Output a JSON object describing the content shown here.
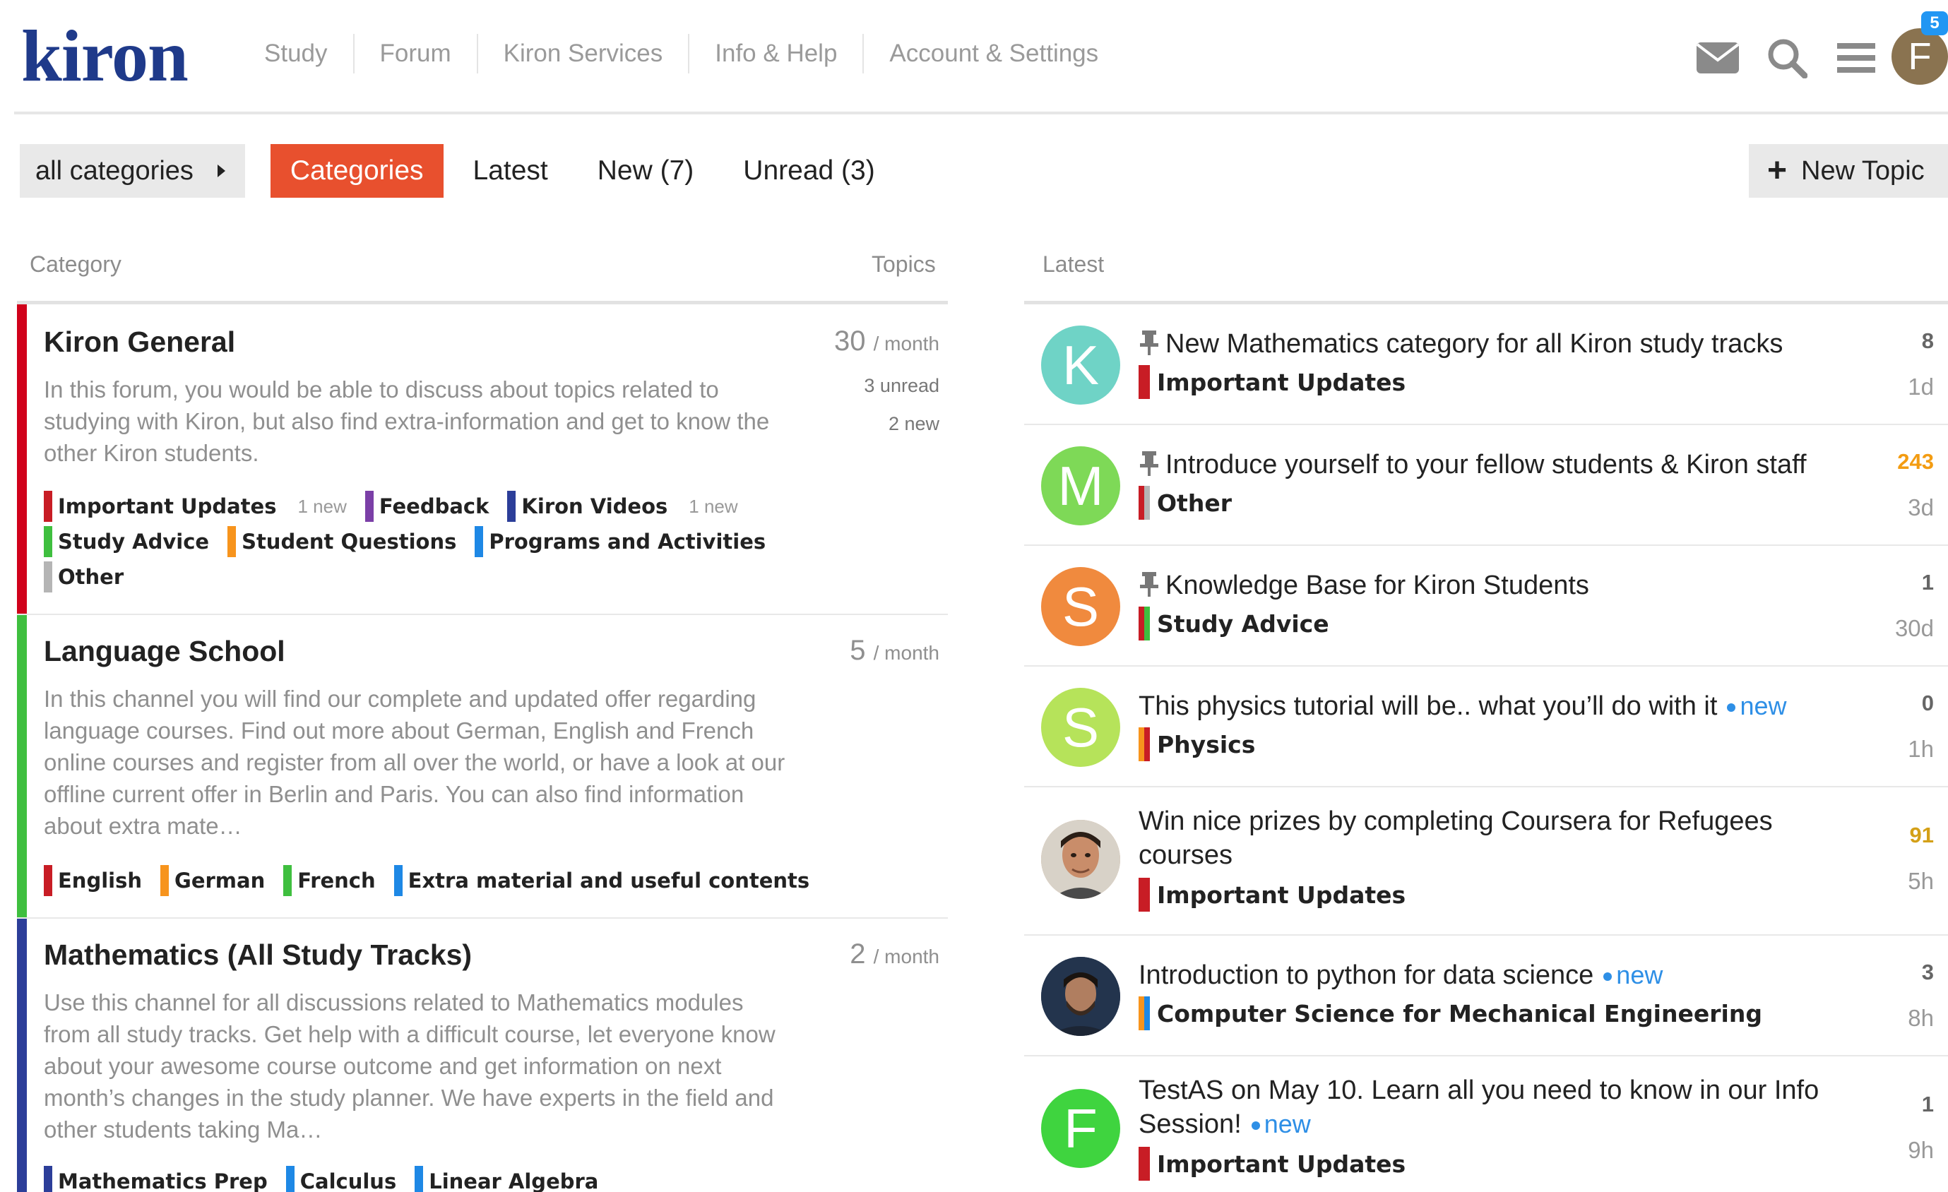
{
  "app": {
    "logo": "kiron",
    "nav": [
      "Study",
      "Forum",
      "Kiron Services",
      "Info & Help",
      "Account & Settings"
    ],
    "avatar_letter": "F",
    "notifications": "5"
  },
  "filters": {
    "dropdown": "all categories",
    "tabs": [
      {
        "label": "Categories",
        "active": true
      },
      {
        "label": "Latest",
        "active": false
      },
      {
        "label": "New (7)",
        "active": false
      },
      {
        "label": "Unread (3)",
        "active": false
      }
    ],
    "new_topic": "New Topic"
  },
  "columns": {
    "category": "Category",
    "topics": "Topics",
    "latest": "Latest"
  },
  "categories": [
    {
      "name": "Kiron General",
      "color": "#d0021b",
      "description": "In this forum, you would be able to discuss about topics related to studying with Kiron, but also find extra-information and get to know the other Kiron students.",
      "count": "30",
      "per": "/ month",
      "unread": "3 unread",
      "new": "2 new",
      "subcategories": [
        [
          {
            "name": "Important Updates",
            "color": "#c81d25",
            "new": "1 new"
          },
          {
            "name": "Feedback",
            "color": "#7b3fa7"
          },
          {
            "name": "Kiron Videos",
            "color": "#2c3e99",
            "new": "1 new"
          }
        ],
        [
          {
            "name": "Study Advice",
            "color": "#3fbf3f"
          },
          {
            "name": "Student Questions",
            "color": "#f7941d"
          },
          {
            "name": "Programs and Activities",
            "color": "#1e88e5"
          }
        ],
        [
          {
            "name": "Other",
            "color": "#b5b5b5"
          }
        ]
      ]
    },
    {
      "name": "Language School",
      "color": "#3fbf3f",
      "description": "In this channel you will find our complete and updated offer regarding language courses. Find out more about German, English and French online courses and register from all over the world, or have a look at our offline current offer in Berlin and Paris. You can also find information about extra mate…",
      "count": "5",
      "per": "/ month",
      "subcategories": [
        [
          {
            "name": "English",
            "color": "#c81d25"
          },
          {
            "name": "German",
            "color": "#f7941d"
          },
          {
            "name": "French",
            "color": "#3fbf3f"
          },
          {
            "name": "Extra material and useful contents",
            "color": "#1e88e5"
          }
        ]
      ]
    },
    {
      "name": "Mathematics (All Study Tracks)",
      "color": "#2c3e99",
      "description": "Use this channel for all discussions related to Mathematics modules from all study tracks. Get help with a difficult course, let everyone know about your awesome course outcome and get information on next month’s changes in the study planner. We have experts in the field and other students taking Ma…",
      "count": "2",
      "per": "/ month",
      "subcategories": [
        [
          {
            "name": "Mathematics Prep",
            "color": "#2c3e99"
          },
          {
            "name": "Calculus",
            "color": "#1e88e5"
          },
          {
            "name": "Linear Algebra",
            "color": "#1e88e5"
          }
        ]
      ]
    }
  ],
  "latest": [
    {
      "title": "New Mathematics category for all Kiron study tracks",
      "pinned": true,
      "category": "Important Updates",
      "colors": [
        "#c81d25",
        "#c81d25"
      ],
      "avatar": "K",
      "avatar_color": "#6fd3c6",
      "replies": "8",
      "replies_color": "#666666",
      "age": "1d"
    },
    {
      "title": "Introduce yourself to your fellow students & Kiron staff",
      "pinned": true,
      "category": "Other",
      "colors": [
        "#c81d25",
        "#b5b5b5"
      ],
      "avatar": "M",
      "avatar_color": "#7ed957",
      "replies": "243",
      "replies_color": "#f39c12",
      "age": "3d"
    },
    {
      "title": "Knowledge Base for Kiron Students",
      "pinned": true,
      "category": "Study Advice",
      "colors": [
        "#c81d25",
        "#3fbf3f"
      ],
      "avatar": "S",
      "avatar_color": "#f08a3e",
      "replies": "1",
      "replies_color": "#666666",
      "age": "30d"
    },
    {
      "title": "This physics tutorial will be.. what you’ll do with it",
      "new": "new",
      "category": "Physics",
      "colors": [
        "#f7941d",
        "#c81d25"
      ],
      "avatar": "S",
      "avatar_color": "#b6e35a",
      "replies": "0",
      "replies_color": "#666666",
      "age": "1h"
    },
    {
      "title": "Win nice prizes by completing Coursera for Refugees courses",
      "category": "Important Updates",
      "colors": [
        "#c81d25",
        "#c81d25"
      ],
      "avatar_kind": "photo1",
      "replies": "91",
      "replies_color": "#d4a017",
      "age": "5h"
    },
    {
      "title": "Introduction to python for data science",
      "new": "new",
      "category": "Computer Science for Mechanical Engineering",
      "colors": [
        "#f7941d",
        "#1e88e5"
      ],
      "avatar_kind": "photo2",
      "replies": "3",
      "replies_color": "#666666",
      "age": "8h"
    },
    {
      "title": "TestAS on May 10. Learn all you need to know in our Info Session!",
      "new": "new",
      "category": "Important Updates",
      "colors": [
        "#c81d25",
        "#c81d25"
      ],
      "avatar": "F",
      "avatar_color": "#3fd43f",
      "replies": "1",
      "replies_color": "#666666",
      "age": "9h"
    }
  ]
}
